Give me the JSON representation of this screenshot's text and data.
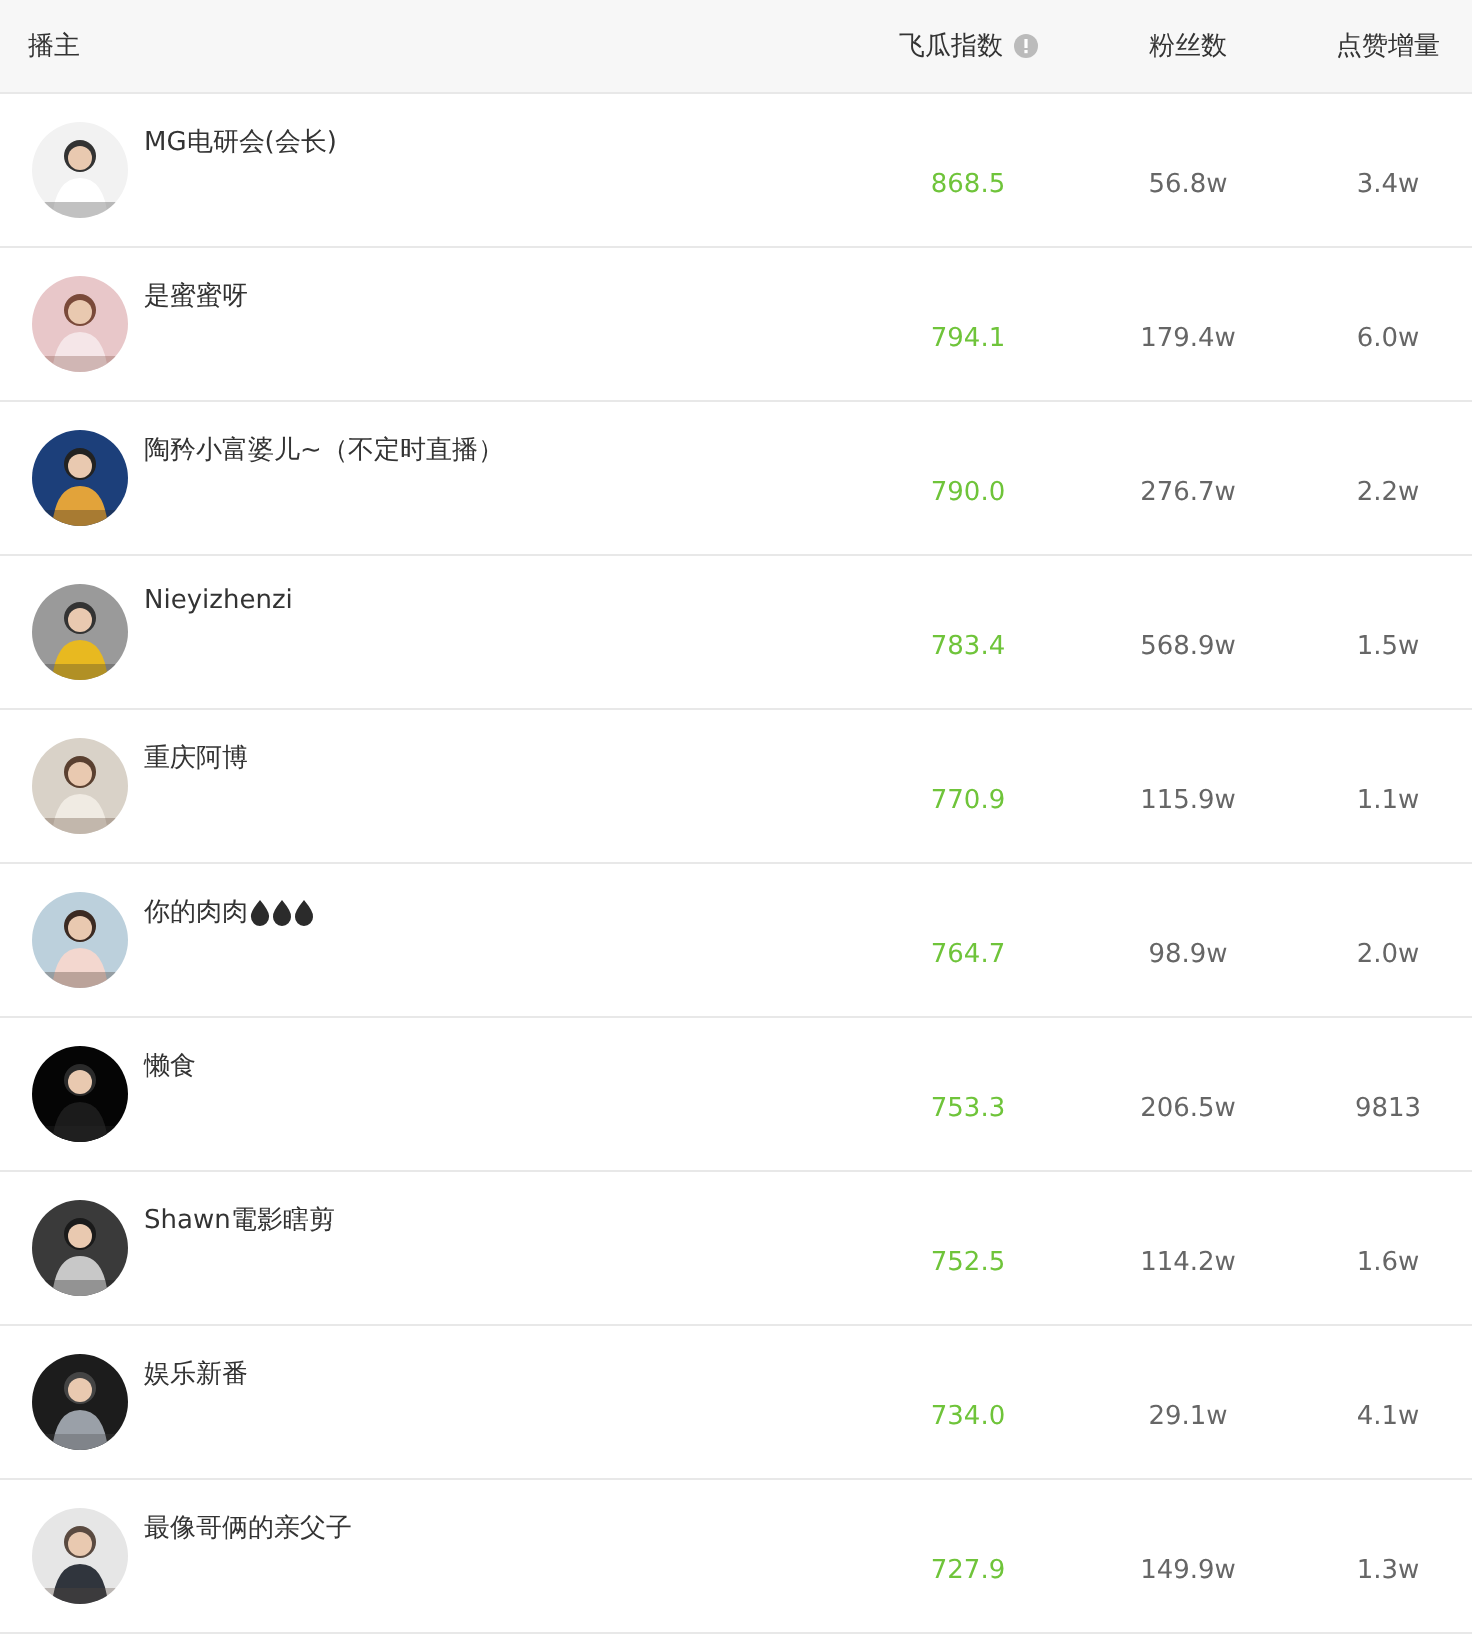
{
  "columns": [
    {
      "label": "播主",
      "kind": "plain"
    },
    {
      "label": "飞瓜指数",
      "kind": "info"
    },
    {
      "label": "粉丝数",
      "kind": "plain"
    },
    {
      "label": "点赞增量",
      "kind": "plain"
    }
  ],
  "rows": [
    {
      "name": "MG电研会(会长)",
      "index": "868.5",
      "fans": "56.8w",
      "likes": "3.4w"
    },
    {
      "name": "是蜜蜜呀",
      "index": "794.1",
      "fans": "179.4w",
      "likes": "6.0w"
    },
    {
      "name": "陶矜小富婆儿~（不定时直播）",
      "index": "790.0",
      "fans": "276.7w",
      "likes": "2.2w"
    },
    {
      "name": "Nieyizhenzi",
      "index": "783.4",
      "fans": "568.9w",
      "likes": "1.5w"
    },
    {
      "name": "重庆阿博",
      "index": "770.9",
      "fans": "115.9w",
      "likes": "1.1w"
    },
    {
      "name": "你的肉肉",
      "decorations": [
        {
          "kind": "drop"
        },
        {
          "kind": "drop"
        },
        {
          "kind": "drop"
        }
      ],
      "index": "764.7",
      "fans": "98.9w",
      "likes": "2.0w"
    },
    {
      "name": "懒食",
      "index": "753.3",
      "fans": "206.5w",
      "likes": "9813"
    },
    {
      "name": "Shawn電影瞎剪",
      "index": "752.5",
      "fans": "114.2w",
      "likes": "1.6w"
    },
    {
      "name": "娱乐新番",
      "index": "734.0",
      "fans": "29.1w",
      "likes": "4.1w"
    },
    {
      "name": "最像哥俩的亲父子",
      "index": "727.9",
      "fans": "149.9w",
      "likes": "1.3w"
    }
  ]
}
